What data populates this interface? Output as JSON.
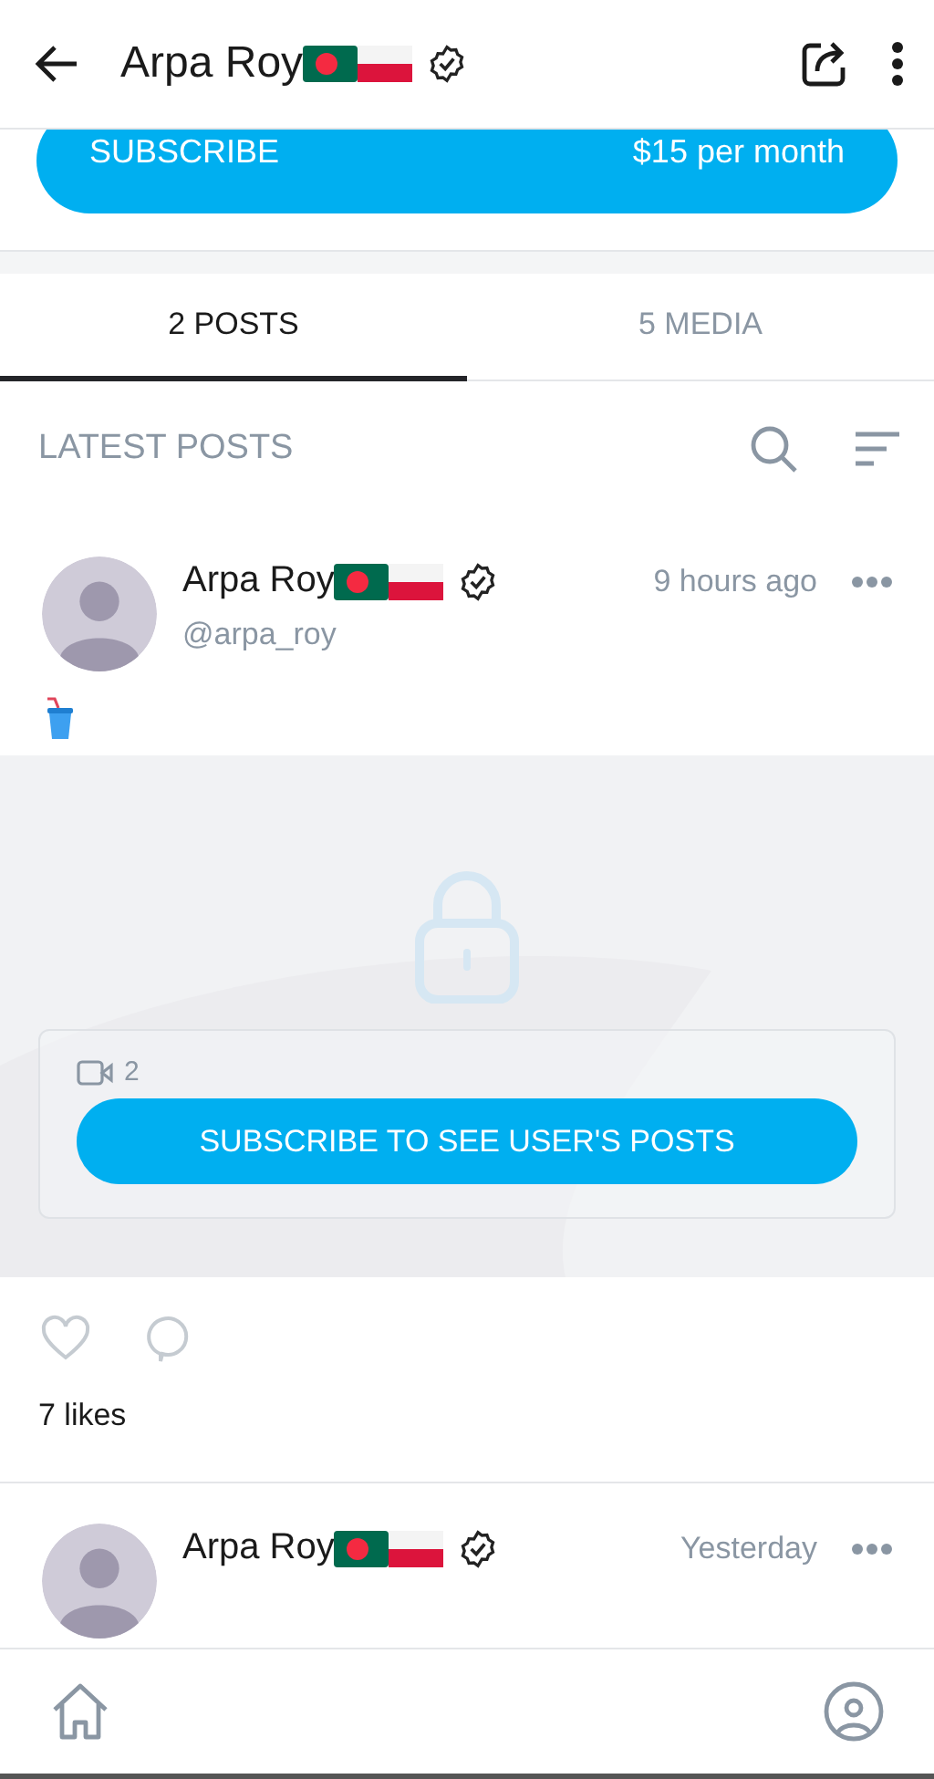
{
  "header": {
    "title": "Arpa Roy"
  },
  "subscribe": {
    "label": "SUBSCRIBE",
    "price": "$15 per month"
  },
  "tabs": [
    {
      "label": "2 POSTS",
      "selected": true
    },
    {
      "label": "5 MEDIA",
      "selected": false
    }
  ],
  "section_title": "LATEST POSTS",
  "posts": [
    {
      "name": "Arpa Roy",
      "handle": "@arpa_roy",
      "time": "9 hours ago",
      "locked": {
        "video_count": "2",
        "button": "SUBSCRIBE TO SEE USER'S POSTS"
      },
      "likes": "7 likes"
    },
    {
      "name": "Arpa Roy",
      "time": "Yesterday"
    }
  ]
}
